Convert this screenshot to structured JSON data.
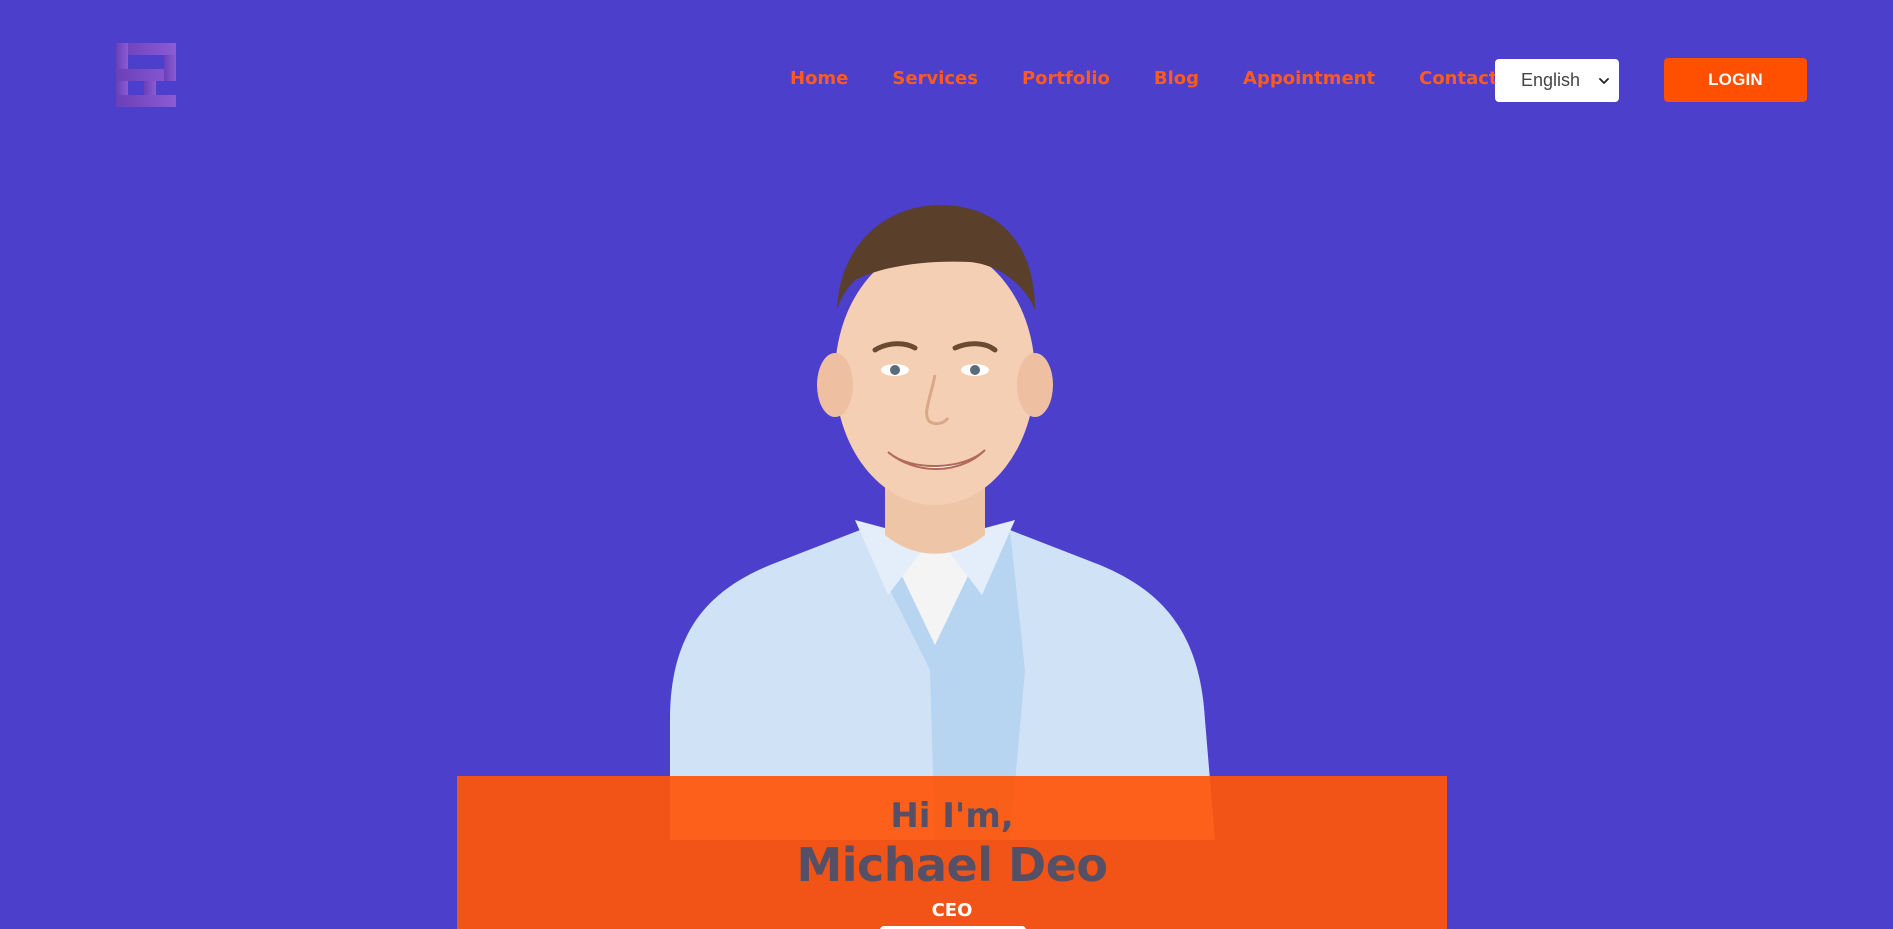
{
  "colors": {
    "background": "#4b3fcb",
    "accent": "#ff5a1f",
    "button": "#ff4f00",
    "card": "#ff560a",
    "name_text": "#555066"
  },
  "logo": {
    "icon": "brand-logo-icon"
  },
  "nav": {
    "items": [
      {
        "label": "Home"
      },
      {
        "label": "Services"
      },
      {
        "label": "Portfolio"
      },
      {
        "label": "Blog"
      },
      {
        "label": "Appointment"
      },
      {
        "label": "Contact"
      }
    ]
  },
  "language_select": {
    "selected": "English",
    "icon": "chevron-down-icon"
  },
  "login_button": {
    "label": "LOGIN"
  },
  "hero": {
    "greeting": "Hi I'm,",
    "name": "Michael Deo",
    "role": "CEO",
    "photo_icon": "profile-photo"
  }
}
